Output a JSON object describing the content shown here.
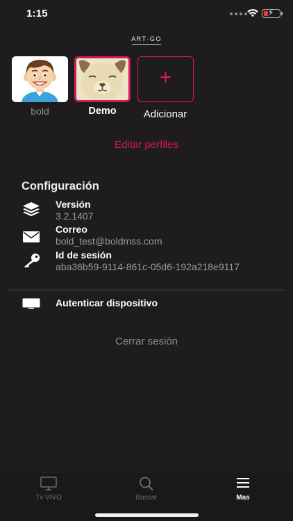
{
  "status_bar": {
    "time": "1:15",
    "battery_color": "#e53935"
  },
  "header": {
    "logo_text": "ART·GO"
  },
  "profiles": [
    {
      "name": "bold",
      "avatar_icon": "boy-face-avatar",
      "selected": false
    },
    {
      "name": "Demo",
      "avatar_icon": "pug-dog-avatar",
      "selected": true
    }
  ],
  "add_profile": {
    "icon": "plus-icon",
    "label": "Adicionar"
  },
  "edit_profiles_label": "Editar perfiles",
  "config": {
    "title": "Configuración",
    "items": [
      {
        "icon": "layers-icon",
        "label": "Versión",
        "value": "3.2.1407"
      },
      {
        "icon": "mail-icon",
        "label": "Correo",
        "value": "bold_test@boldmss.com"
      },
      {
        "icon": "key-icon",
        "label": "Id de sesión",
        "value": "aba36b59-9114-861c-05d6-192a218e9117"
      }
    ]
  },
  "authenticate_device": {
    "icon": "tv-icon",
    "label": "Autenticar dispositivo"
  },
  "logout_label": "Cerrar sesión",
  "tabbar": {
    "tabs": [
      {
        "label": "Tv VIVO",
        "icon": "tv-outline-icon",
        "active": false
      },
      {
        "label": "Buscar",
        "icon": "search-icon",
        "active": false
      },
      {
        "label": "Mas",
        "icon": "menu-icon",
        "active": true
      }
    ]
  },
  "colors": {
    "accent": "#d6195f",
    "background": "#1e1c1d",
    "muted_text": "#9a9a9a"
  }
}
